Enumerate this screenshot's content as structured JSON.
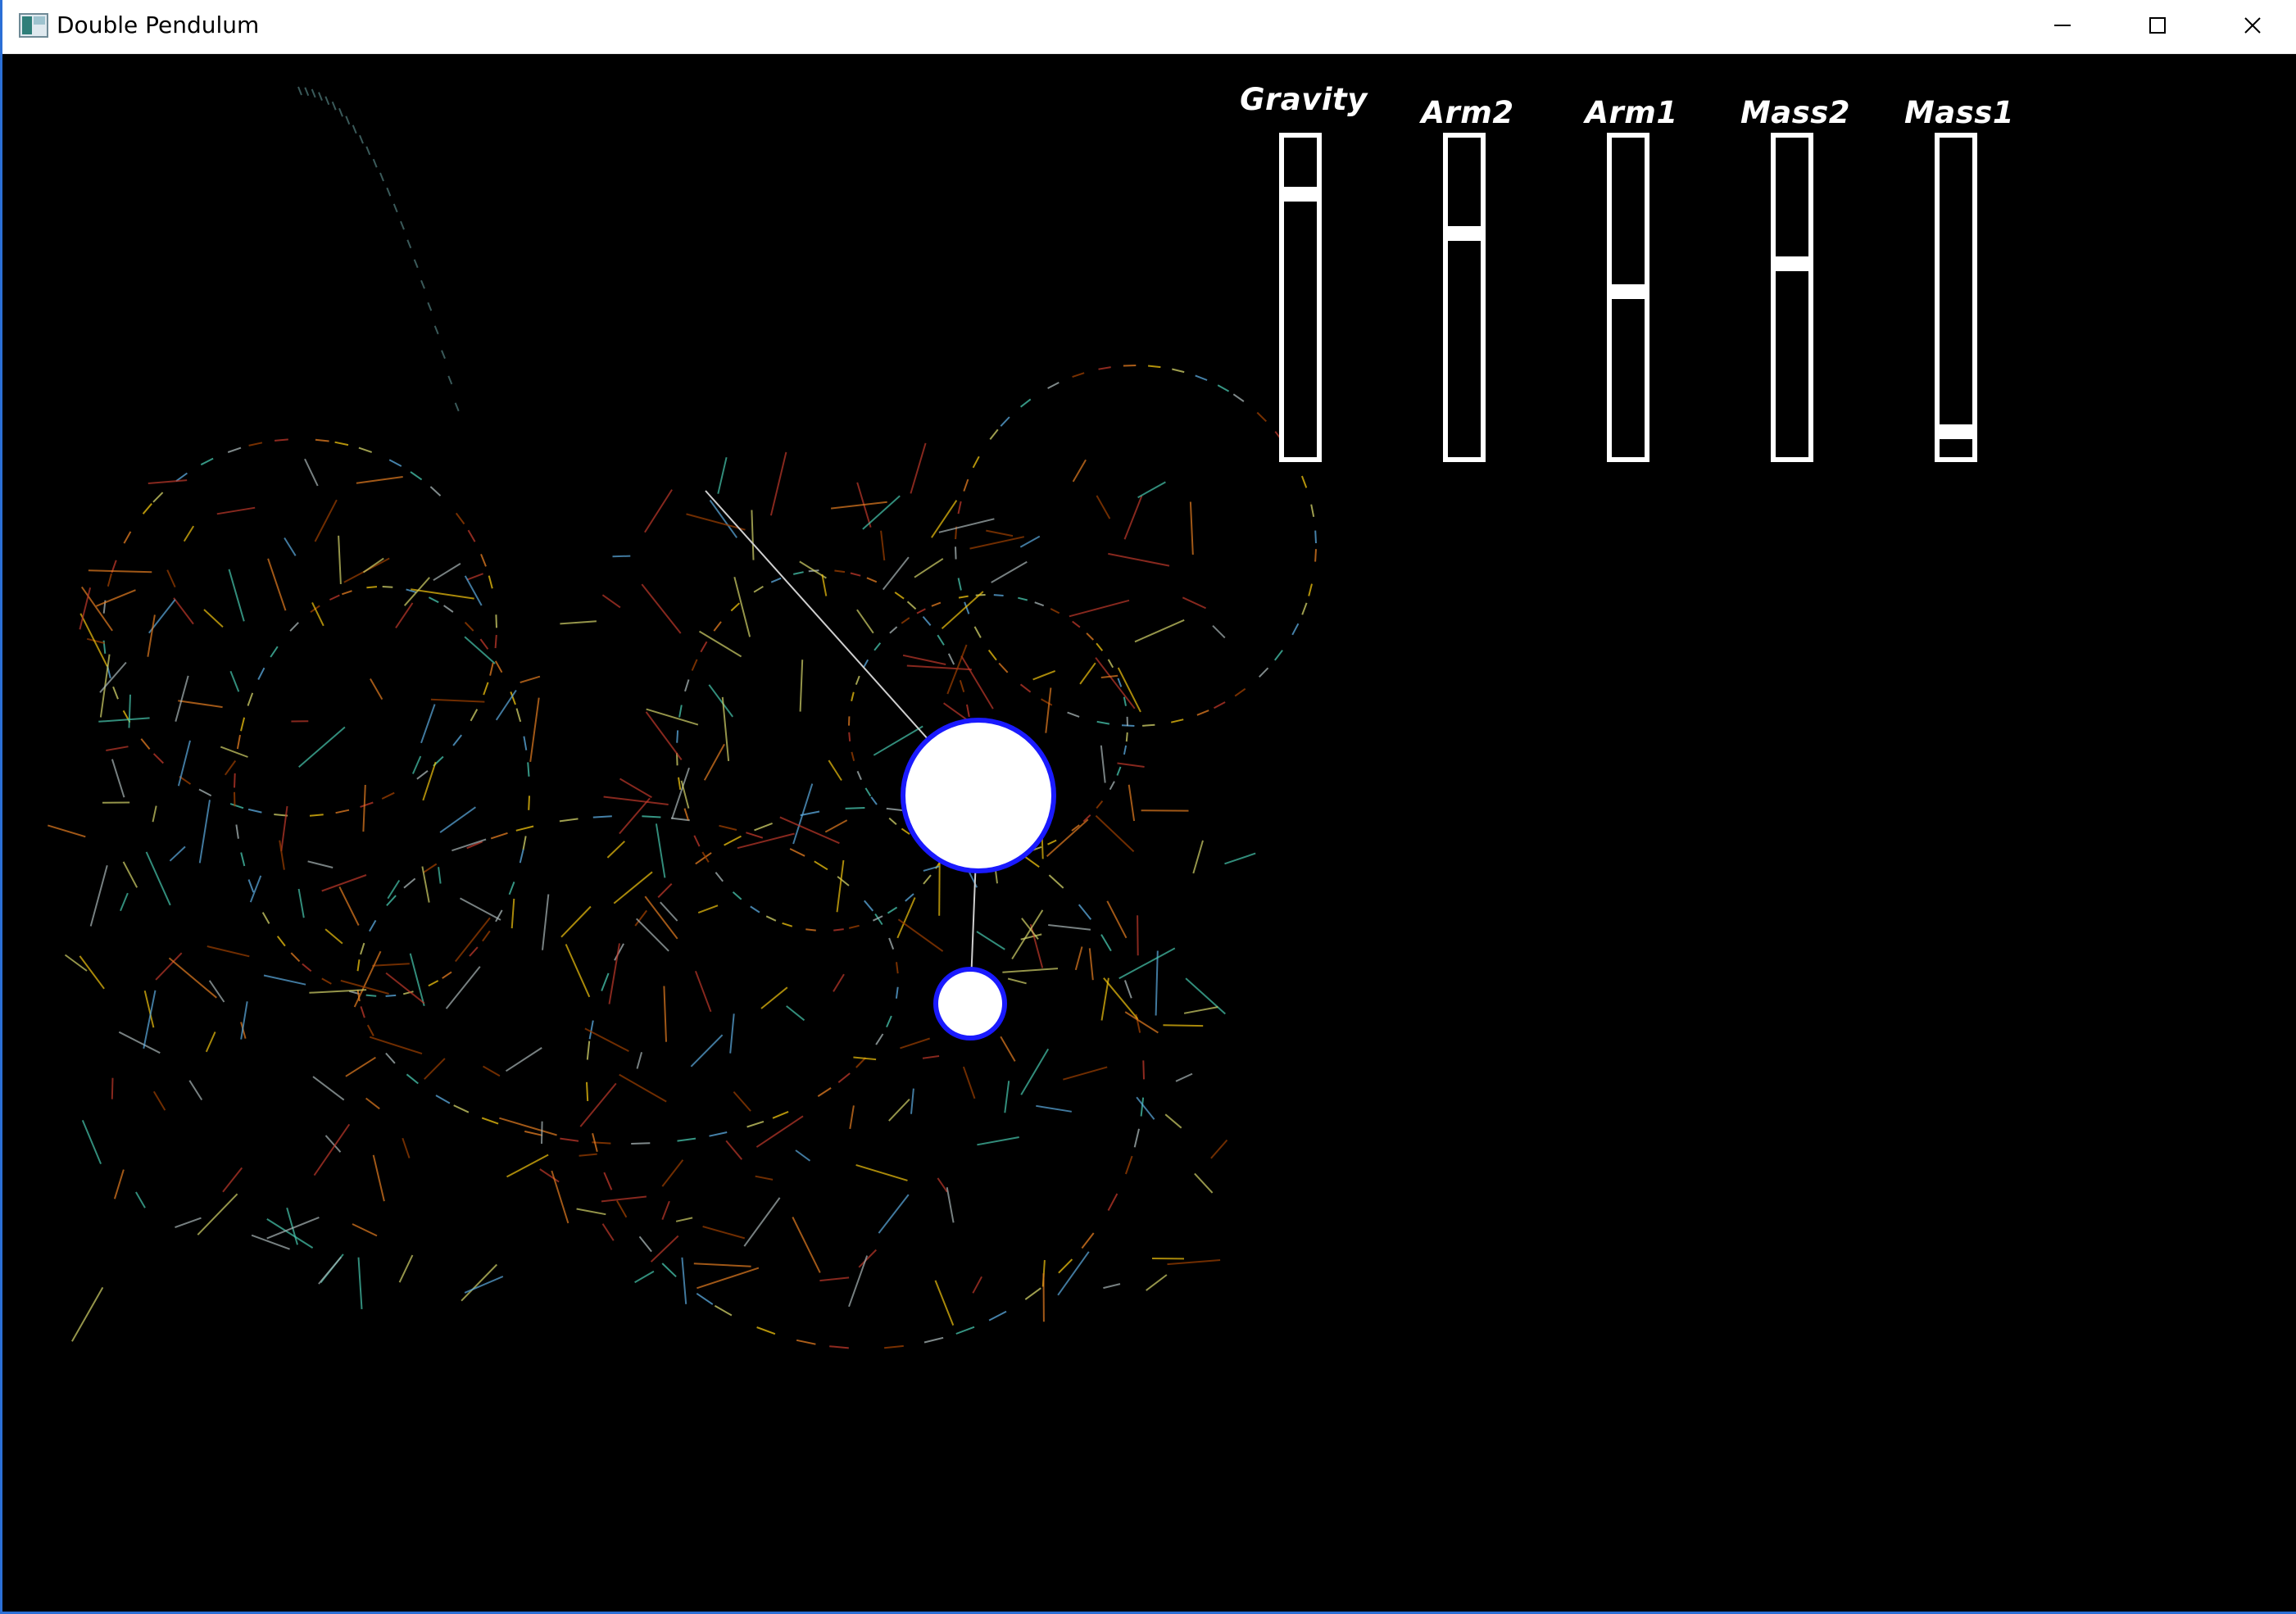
{
  "window": {
    "title": "Double Pendulum",
    "controls": {
      "minimize_icon": "minimize-icon",
      "maximize_icon": "maximize-icon",
      "close_icon": "close-icon"
    }
  },
  "sliders": [
    {
      "label": "Gravity",
      "level": 0.84
    },
    {
      "label": "Arm2",
      "level": 0.71
    },
    {
      "label": "Arm1",
      "level": 0.52
    },
    {
      "label": "Mass2",
      "level": 0.61
    },
    {
      "label": "Mass1",
      "level": 0.06
    }
  ],
  "pendulum": {
    "bob_color": "#ffffff",
    "bob_outline_color": "#1a1aff",
    "rod_color": "#cfcfcf"
  },
  "colors": {
    "background": "#000000",
    "trail_colors": [
      "#c0392b",
      "#e67e22",
      "#f1c40f",
      "#d4d46a",
      "#5dade2",
      "#48c9b0",
      "#aab7b8",
      "#a04000"
    ],
    "accent_border": "#2b6fd6"
  }
}
